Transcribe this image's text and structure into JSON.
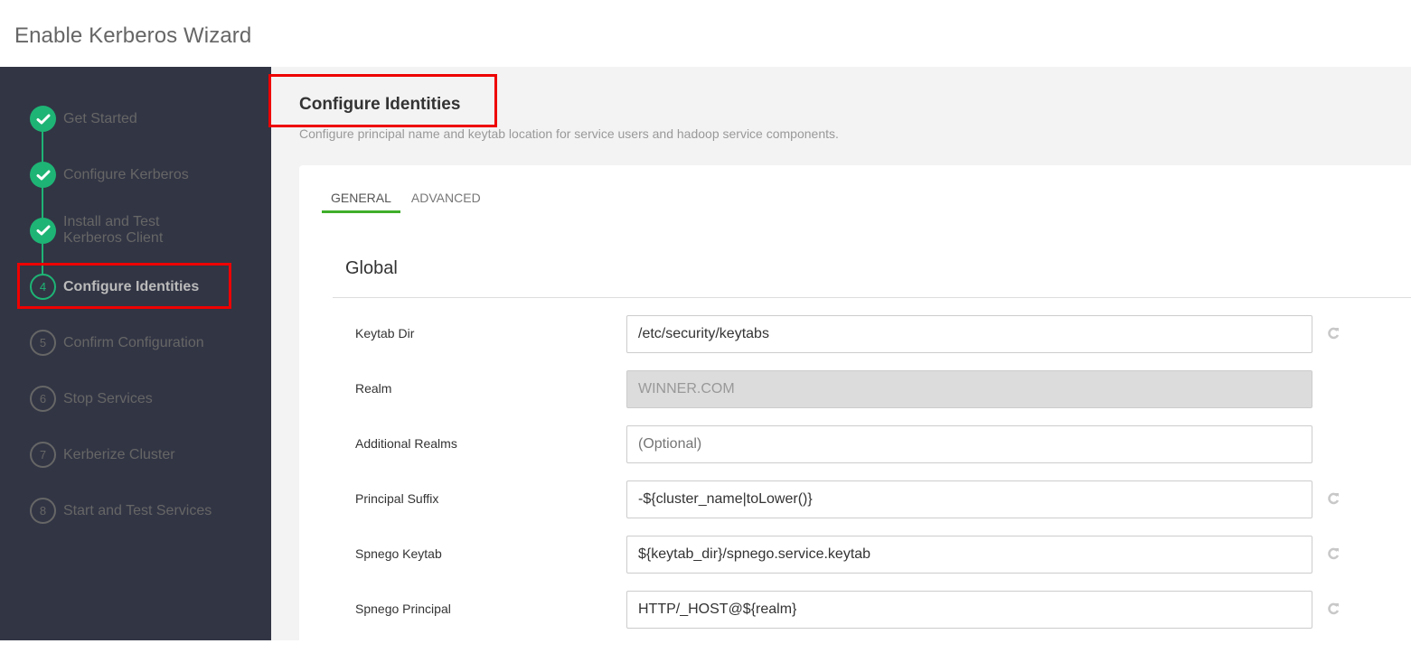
{
  "header": {
    "title": "Enable Kerberos Wizard"
  },
  "sidebar": {
    "steps": [
      {
        "label": "Get Started",
        "status": "done",
        "icon": "check-icon"
      },
      {
        "label": "Configure Kerberos",
        "status": "done",
        "icon": "check-icon"
      },
      {
        "label": "Install and Test",
        "label2": "Kerberos Client",
        "status": "done",
        "icon": "check-icon"
      },
      {
        "number": "4",
        "label": "Configure Identities",
        "status": "active"
      },
      {
        "number": "5",
        "label": "Confirm Configuration",
        "status": "todo"
      },
      {
        "number": "6",
        "label": "Stop Services",
        "status": "todo"
      },
      {
        "number": "7",
        "label": "Kerberize Cluster",
        "status": "todo"
      },
      {
        "number": "8",
        "label": "Start and Test Services",
        "status": "todo"
      }
    ]
  },
  "main": {
    "title": "Configure Identities",
    "description": "Configure principal name and keytab location for service users and hadoop service components.",
    "tabs": [
      {
        "label": "GENERAL",
        "active": true
      },
      {
        "label": "ADVANCED",
        "active": false
      }
    ],
    "section_title": "Global",
    "fields": [
      {
        "label": "Keytab Dir",
        "value": "/etc/security/keytabs",
        "reset_icon": "refresh-icon"
      },
      {
        "label": "Realm",
        "value": "WINNER.COM",
        "disabled": true
      },
      {
        "label": "Additional Realms",
        "value": "",
        "placeholder": "(Optional)"
      },
      {
        "label": "Principal Suffix",
        "value": "-${cluster_name|toLower()}",
        "reset_icon": "refresh-icon"
      },
      {
        "label": "Spnego Keytab",
        "value": "${keytab_dir}/spnego.service.keytab",
        "reset_icon": "refresh-icon"
      },
      {
        "label": "Spnego Principal",
        "value": "HTTP/_HOST@${realm}",
        "reset_icon": "refresh-icon"
      }
    ]
  },
  "colors": {
    "sidebar_bg": "#323544",
    "step_done": "#1eb475",
    "tab_active_underline": "#3fae2a",
    "highlight_box": "#ee0000"
  }
}
